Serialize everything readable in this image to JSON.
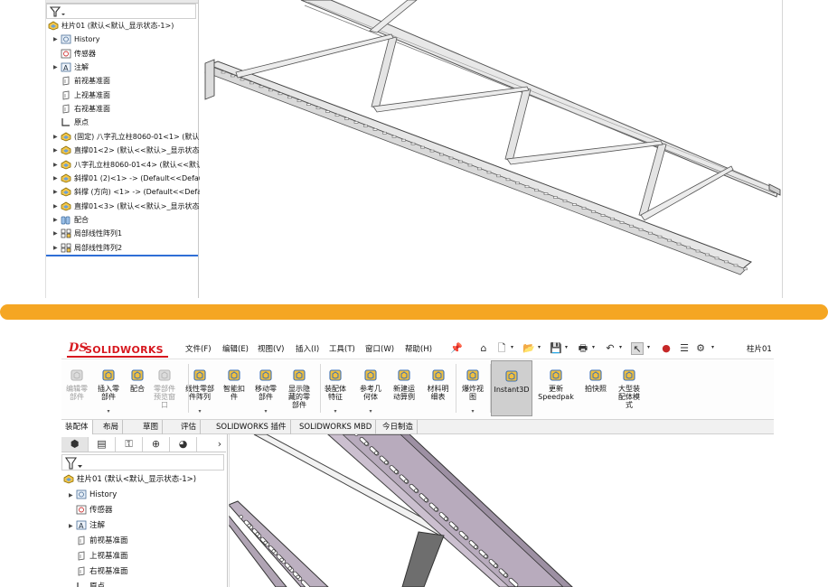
{
  "top_screenshot": {
    "feature_tree": {
      "root": "柱片01 (默认<默认_显示状态-1>)",
      "items": [
        {
          "label": "History",
          "icon": "history-icon",
          "arrow": true
        },
        {
          "label": "传感器",
          "icon": "sensor-icon",
          "arrow": false
        },
        {
          "label": "注解",
          "icon": "annotation-icon",
          "arrow": true
        },
        {
          "label": "前视基准面",
          "icon": "plane-icon",
          "arrow": false
        },
        {
          "label": "上视基准面",
          "icon": "plane-icon",
          "arrow": false
        },
        {
          "label": "右视基准面",
          "icon": "plane-icon",
          "arrow": false
        },
        {
          "label": "原点",
          "icon": "origin-icon",
          "arrow": false
        },
        {
          "label": "(固定) 八字孔立柱8060-01<1> (默认<",
          "icon": "part-icon",
          "arrow": true
        },
        {
          "label": "直撑01<2> (默认<<默认>_显示状态",
          "icon": "part-icon",
          "arrow": true
        },
        {
          "label": "八字孔立柱8060-01<4> (默认<<默认",
          "icon": "part-icon",
          "arrow": true
        },
        {
          "label": "斜撑01 (2)<1> -> (Default<<Default>_",
          "icon": "part-icon",
          "arrow": true
        },
        {
          "label": "斜撑 (方向) <1> -> (Default<<Defau",
          "icon": "part-icon",
          "arrow": true
        },
        {
          "label": "直撑01<3> (默认<<默认>_显示状态",
          "icon": "part-icon",
          "arrow": true
        },
        {
          "label": "配合",
          "icon": "mates-icon",
          "arrow": true
        },
        {
          "label": "局部线性阵列1",
          "icon": "pattern-icon",
          "arrow": true
        },
        {
          "label": "局部线性阵列2",
          "icon": "pattern-icon",
          "arrow": true
        }
      ]
    }
  },
  "bottom_screenshot": {
    "logo": {
      "ds": "DS",
      "text": "SOLIDWORKS"
    },
    "menu": [
      "文件(F)",
      "编辑(E)",
      "视图(V)",
      "插入(I)",
      "工具(T)",
      "窗口(W)",
      "帮助(H)"
    ],
    "document_title": "柱片01",
    "commands": [
      {
        "label": "编辑零\n部件",
        "icon": "edit-component-icon",
        "disabled": true,
        "drop": false
      },
      {
        "label": "插入零\n部件",
        "icon": "insert-component-icon",
        "disabled": false,
        "drop": true
      },
      {
        "label": "配合",
        "icon": "mate-icon",
        "disabled": false,
        "drop": false
      },
      {
        "label": "零部件\n预览窗\n口",
        "icon": "component-preview-icon",
        "disabled": true,
        "drop": false
      },
      {
        "label": "线性零部\n件阵列",
        "icon": "linear-pattern-icon",
        "disabled": false,
        "drop": true
      },
      {
        "label": "智能扣\n件",
        "icon": "smart-fastener-icon",
        "disabled": false,
        "drop": false
      },
      {
        "label": "移动零\n部件",
        "icon": "move-component-icon",
        "disabled": false,
        "drop": true
      },
      {
        "label": "显示隐\n藏的零\n部件",
        "icon": "show-hidden-icon",
        "disabled": false,
        "drop": false
      },
      {
        "label": "装配体\n特征",
        "icon": "assembly-feature-icon",
        "disabled": false,
        "drop": true
      },
      {
        "label": "参考几\n何体",
        "icon": "reference-geometry-icon",
        "disabled": false,
        "drop": true
      },
      {
        "label": "新建运\n动算例",
        "icon": "motion-study-icon",
        "disabled": false,
        "drop": false
      },
      {
        "label": "材料明\n细表",
        "icon": "bom-icon",
        "disabled": false,
        "drop": false
      },
      {
        "label": "爆炸视\n图",
        "icon": "exploded-view-icon",
        "disabled": false,
        "drop": true
      },
      {
        "label": "Instant3D",
        "icon": "instant3d-icon",
        "disabled": false,
        "drop": false,
        "active": true
      },
      {
        "label": "更新\nSpeedpak",
        "icon": "speedpak-icon",
        "disabled": false,
        "drop": false
      },
      {
        "label": "拍快照",
        "icon": "snapshot-icon",
        "disabled": false,
        "drop": false
      },
      {
        "label": "大型装\n配体模\n式",
        "icon": "large-assembly-icon",
        "disabled": false,
        "drop": false
      }
    ],
    "tabs": [
      "装配体",
      "布局",
      "草图",
      "评估",
      "SOLIDWORKS 插件",
      "SOLIDWORKS MBD",
      "今日制造"
    ],
    "active_tab": 0,
    "feature_tree": {
      "root": "柱片01 (默认<默认_显示状态-1>)",
      "items": [
        {
          "label": "History",
          "icon": "history-icon",
          "arrow": true
        },
        {
          "label": "传感器",
          "icon": "sensor-icon",
          "arrow": false
        },
        {
          "label": "注解",
          "icon": "annotation-icon",
          "arrow": true
        },
        {
          "label": "前视基准面",
          "icon": "plane-icon",
          "arrow": false
        },
        {
          "label": "上视基准面",
          "icon": "plane-icon",
          "arrow": false
        },
        {
          "label": "右视基准面",
          "icon": "plane-icon",
          "arrow": false
        },
        {
          "label": "原点",
          "icon": "origin-icon",
          "arrow": false
        }
      ]
    },
    "panel_tabs": [
      "feature-manager-icon",
      "property-manager-icon",
      "configuration-manager-icon",
      "dimxpert-icon",
      "display-manager-icon"
    ],
    "panel_chevron": "›"
  },
  "colors": {
    "separator": "#f5a623",
    "solidworks_red": "#d71920",
    "selection_blue": "#2f6fd6",
    "beam_purple": "#b6a9bb"
  }
}
